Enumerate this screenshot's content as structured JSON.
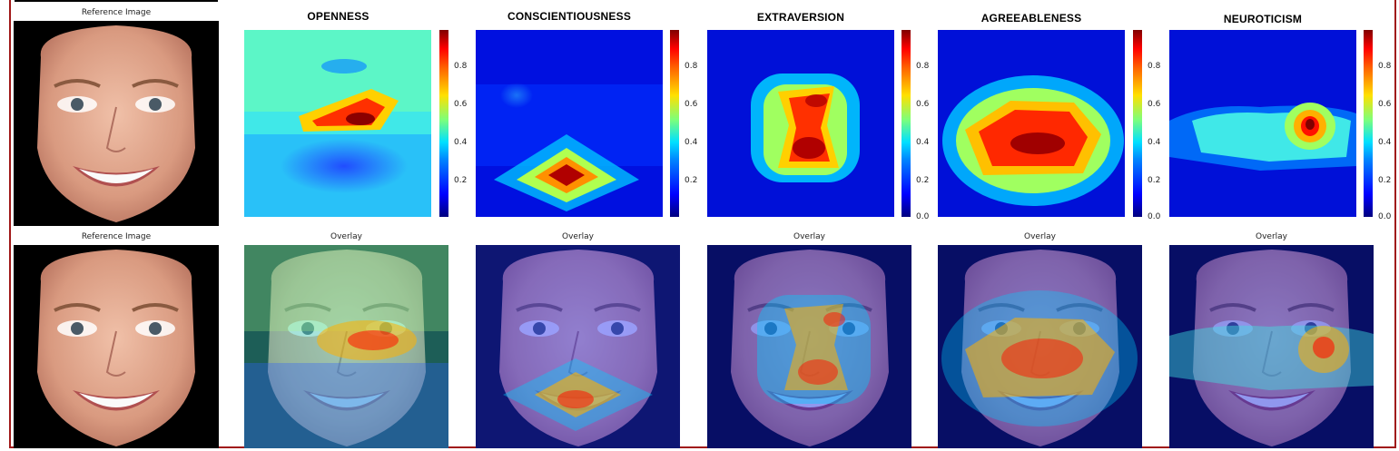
{
  "reference_label": "Reference Image",
  "overlay_label": "Overlay",
  "traits": [
    {
      "name": "OPENNESS",
      "ticks": [
        "0.8",
        "0.6",
        "0.4",
        "0.2"
      ]
    },
    {
      "name": "CONSCIENTIOUSNESS",
      "ticks": [
        "0.8",
        "0.6",
        "0.4",
        "0.2"
      ]
    },
    {
      "name": "EXTRAVERSION",
      "ticks": [
        "0.8",
        "0.6",
        "0.4",
        "0.2",
        "0.0"
      ]
    },
    {
      "name": "AGREEABLENESS",
      "ticks": [
        "0.8",
        "0.6",
        "0.4",
        "0.2",
        "0.0"
      ]
    },
    {
      "name": "NEUROTICISM",
      "ticks": [
        "0.8",
        "0.6",
        "0.4",
        "0.2",
        "0.0"
      ]
    }
  ],
  "colors": {
    "frame": "#a01818",
    "colormap": "jet"
  }
}
